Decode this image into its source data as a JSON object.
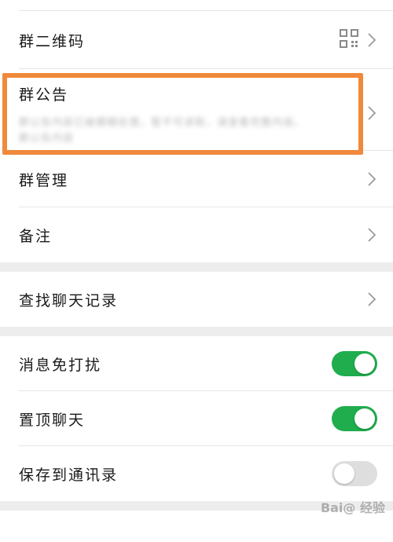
{
  "group_qr": {
    "label": "群二维码",
    "icon": "qr-code-icon"
  },
  "group_notice": {
    "label": "群公告",
    "line1": "群公告内容已被模糊处理，暂不可读取，请查看完整内容。",
    "line2": "群公告内容"
  },
  "group_manage": {
    "label": "群管理"
  },
  "remark": {
    "label": "备注"
  },
  "search_history": {
    "label": "查找聊天记录"
  },
  "mute": {
    "label": "消息免打扰",
    "on": true
  },
  "pin": {
    "label": "置顶聊天",
    "on": true
  },
  "save_contacts": {
    "label": "保存到通讯录",
    "on": false
  },
  "watermark": "Bai@ 经验",
  "colors": {
    "accent": "#1fad4e",
    "highlight": "#f0893b"
  }
}
